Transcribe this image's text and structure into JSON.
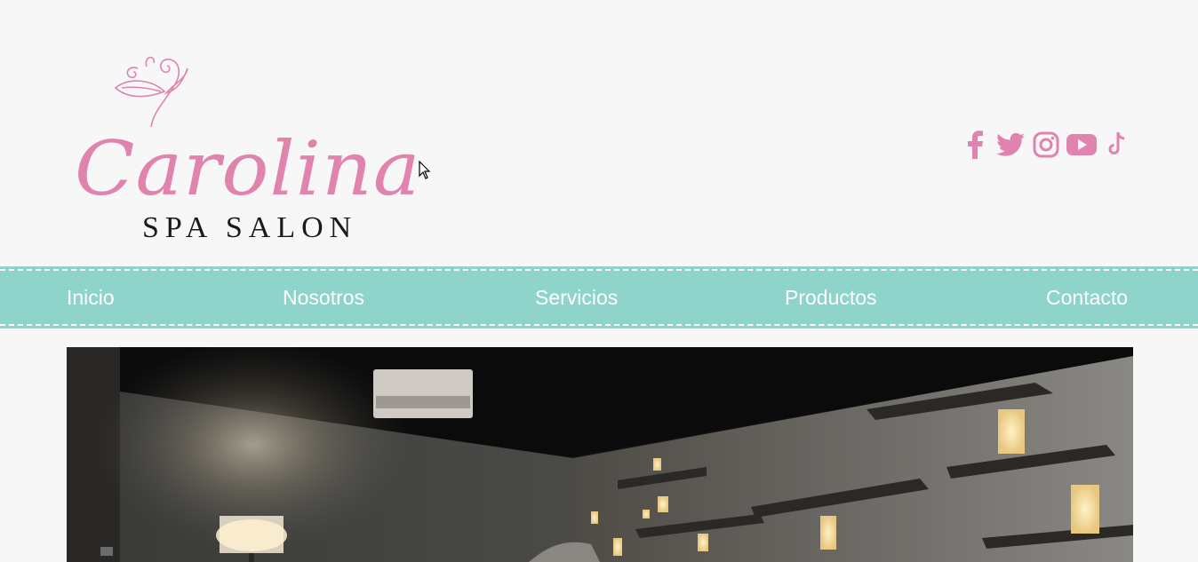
{
  "brand": {
    "script_name": "Carolina",
    "subtitle": "SPA SALON",
    "accent_color": "#e083ae"
  },
  "social": {
    "icons": [
      "facebook-icon",
      "twitter-icon",
      "instagram-icon",
      "youtube-icon",
      "tiktok-icon"
    ]
  },
  "nav": {
    "background": "#8ed4ca",
    "items": [
      {
        "label": "Inicio"
      },
      {
        "label": "Nosotros"
      },
      {
        "label": "Servicios"
      },
      {
        "label": "Productos"
      },
      {
        "label": "Contacto"
      }
    ]
  }
}
